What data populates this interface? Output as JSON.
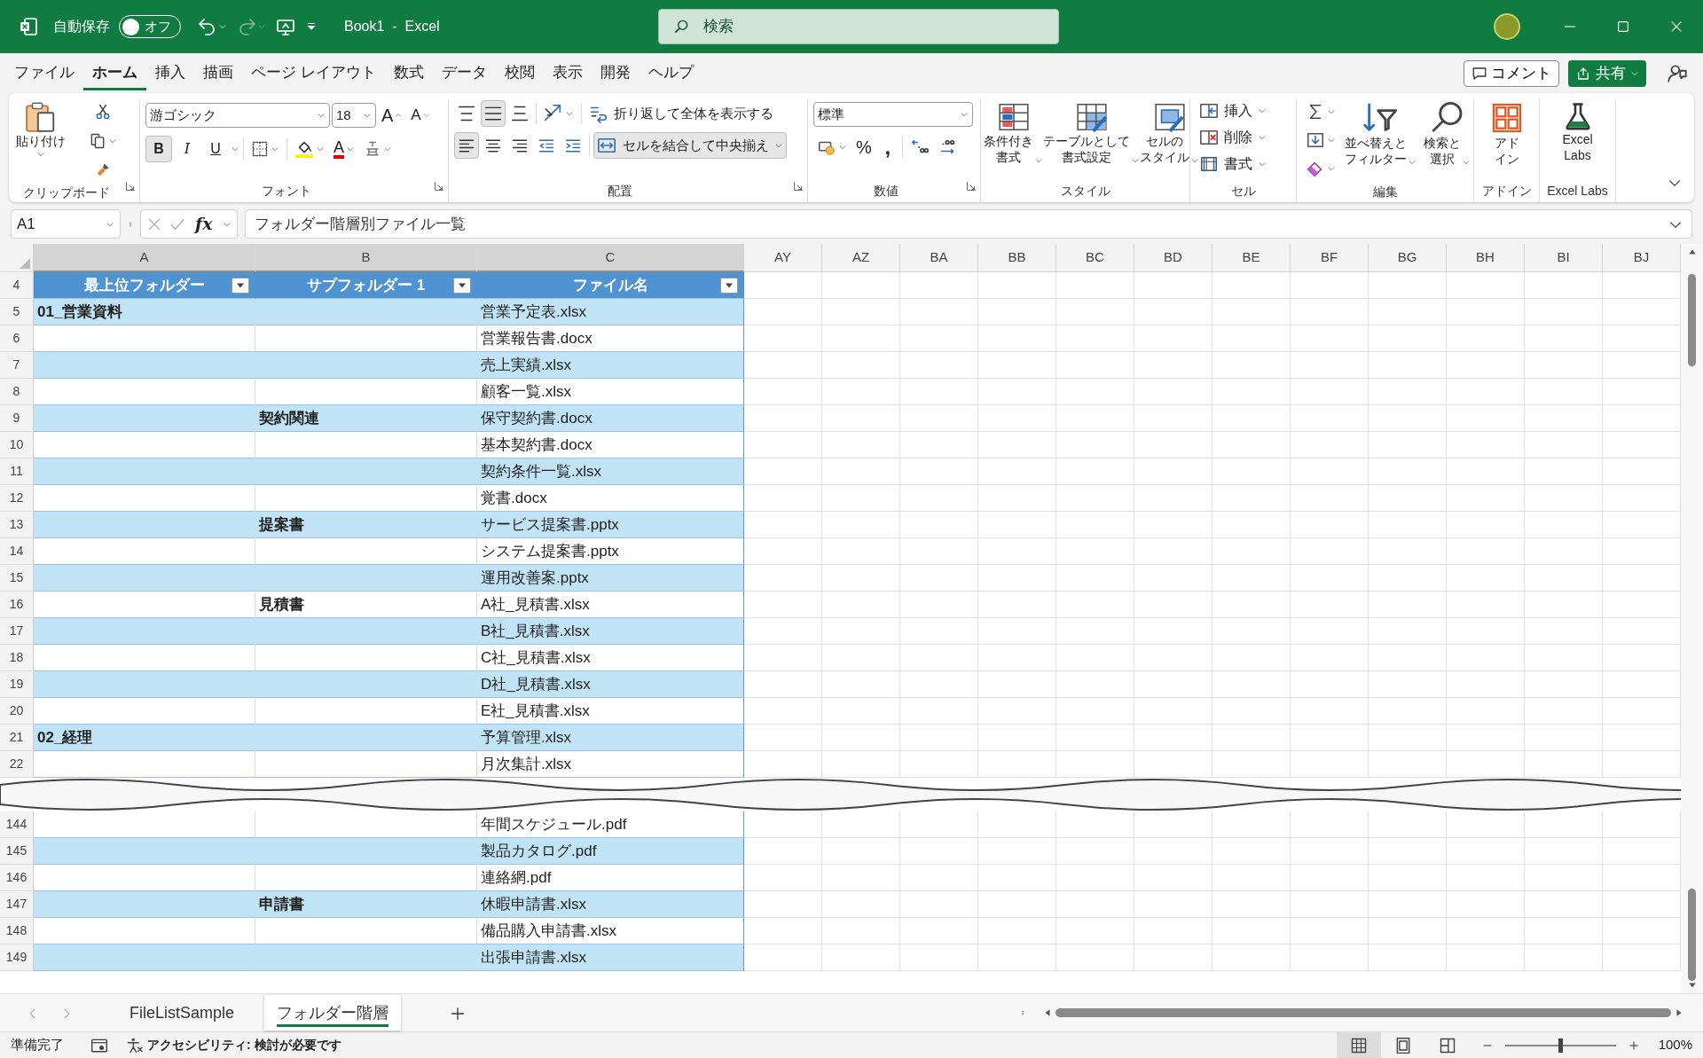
{
  "title_bar": {
    "autosave_label": "自動保存",
    "autosave": {
      "label": "オフ",
      "on": false
    },
    "title": "Book1  -  Excel",
    "search": {
      "placeholder": "検索"
    }
  },
  "menu_tabs": [
    {
      "label": "ファイル",
      "selected": false
    },
    {
      "label": "ホーム",
      "selected": true
    },
    {
      "label": "挿入",
      "selected": false
    },
    {
      "label": "描画",
      "selected": false
    },
    {
      "label": "ページ レイアウト",
      "selected": false
    },
    {
      "label": "数式",
      "selected": false
    },
    {
      "label": "データ",
      "selected": false
    },
    {
      "label": "校閲",
      "selected": false
    },
    {
      "label": "表示",
      "selected": false
    },
    {
      "label": "開発",
      "selected": false
    },
    {
      "label": "ヘルプ",
      "selected": false
    }
  ],
  "comment_button": "コメント",
  "share_button": "共有",
  "ribbon": {
    "clipboard": {
      "paste": "貼り付け",
      "label": "クリップボード"
    },
    "font": {
      "name": "游ゴシック",
      "size": "18",
      "grow": "A",
      "shrink": "A",
      "bold": {
        "label": "B",
        "on": true
      },
      "italic": {
        "label": "I",
        "on": false
      },
      "underline": {
        "label": "U",
        "on": false
      },
      "font_color": "A",
      "label": "フォント"
    },
    "alignment": {
      "vertical": [
        {
          "selected": false
        },
        {
          "selected": true
        },
        {
          "selected": false
        }
      ],
      "horizontal": [
        {
          "selected": true
        },
        {
          "selected": false
        },
        {
          "selected": false
        }
      ],
      "wrap": {
        "label": "折り返して全体を表示する",
        "on": false
      },
      "merge": {
        "label": "セルを結合して中央揃え",
        "on": true
      },
      "label": "配置"
    },
    "number": {
      "format": "標準",
      "percent": "%",
      "comma": ",",
      "label": "数値"
    },
    "styles": {
      "items": [
        [
          "条件付き",
          "書式"
        ],
        [
          "テーブルとして",
          "書式設定"
        ],
        [
          "セルの",
          "スタイル"
        ]
      ],
      "label": "スタイル"
    },
    "cells": {
      "items": [
        "挿入",
        "削除",
        "書式"
      ],
      "label": "セル"
    },
    "editing": {
      "items": [
        [
          "並べ替えと",
          "フィルター"
        ],
        [
          "検索と",
          "選択"
        ]
      ],
      "label": "編集"
    },
    "addins": {
      "button": [
        "アド",
        "イン"
      ],
      "label": "アドイン"
    },
    "excel_labs": {
      "button": [
        "Excel",
        "Labs"
      ],
      "label": "Excel Labs"
    }
  },
  "formula_bar": {
    "name_box": "A1",
    "fx": "fx",
    "formula": "フォルダー階層別ファイル一覧"
  },
  "columns": [
    {
      "label": "A",
      "highlighted": true
    },
    {
      "label": "B",
      "highlighted": true
    },
    {
      "label": "C",
      "highlighted": true
    },
    {
      "label": "AY",
      "highlighted": false
    },
    {
      "label": "AZ",
      "highlighted": false
    },
    {
      "label": "BA",
      "highlighted": false
    },
    {
      "label": "BB",
      "highlighted": false
    },
    {
      "label": "BC",
      "highlighted": false
    },
    {
      "label": "BD",
      "highlighted": false
    },
    {
      "label": "BE",
      "highlighted": false
    },
    {
      "label": "BF",
      "highlighted": false
    },
    {
      "label": "BG",
      "highlighted": false
    },
    {
      "label": "BH",
      "highlighted": false
    },
    {
      "label": "BI",
      "highlighted": false
    },
    {
      "label": "BJ",
      "highlighted": false
    }
  ],
  "table": {
    "header_row": "4",
    "headers": [
      "最上位フォルダー",
      "サブフォルダー 1",
      "ファイル名"
    ],
    "rows": [
      {
        "row": "5",
        "a": "01_営業資料",
        "c": "営業予定表.xlsx",
        "shaded": true
      },
      {
        "row": "6",
        "c": "営業報告書.docx",
        "shaded": false
      },
      {
        "row": "7",
        "c": "売上実績.xlsx",
        "shaded": true
      },
      {
        "row": "8",
        "c": "顧客一覧.xlsx",
        "shaded": false
      },
      {
        "row": "9",
        "b": "契約関連",
        "c": "保守契約書.docx",
        "shaded": true
      },
      {
        "row": "10",
        "c": "基本契約書.docx",
        "shaded": false
      },
      {
        "row": "11",
        "c": "契約条件一覧.xlsx",
        "shaded": true
      },
      {
        "row": "12",
        "c": "覚書.docx",
        "shaded": false
      },
      {
        "row": "13",
        "b": "提案書",
        "c": "サービス提案書.pptx",
        "shaded": true
      },
      {
        "row": "14",
        "c": "システム提案書.pptx",
        "shaded": false
      },
      {
        "row": "15",
        "c": "運用改善案.pptx",
        "shaded": true
      },
      {
        "row": "16",
        "b": "見積書",
        "c": "A社_見積書.xlsx",
        "shaded": false
      },
      {
        "row": "17",
        "c": "B社_見積書.xlsx",
        "shaded": true
      },
      {
        "row": "18",
        "c": "C社_見積書.xlsx",
        "shaded": false
      },
      {
        "row": "19",
        "c": "D社_見積書.xlsx",
        "shaded": true
      },
      {
        "row": "20",
        "c": "E社_見積書.xlsx",
        "shaded": false
      },
      {
        "row": "21",
        "a": "02_経理",
        "c": "予算管理.xlsx",
        "shaded": true
      },
      {
        "row": "22",
        "c": "月次集計.xlsx",
        "shaded": false
      }
    ],
    "rows_after_break": [
      {
        "row": "144",
        "c": "年間スケジュール.pdf",
        "shaded": false
      },
      {
        "row": "145",
        "c": "製品カタログ.pdf",
        "shaded": true
      },
      {
        "row": "146",
        "c": "連絡網.pdf",
        "shaded": false
      },
      {
        "row": "147",
        "b": "申請書",
        "c": "休暇申請書.xlsx",
        "shaded": true
      },
      {
        "row": "148",
        "c": "備品購入申請書.xlsx",
        "shaded": false
      },
      {
        "row": "149",
        "c": "出張申請書.xlsx",
        "shaded": true
      }
    ]
  },
  "sheet_tabs": [
    {
      "label": "FileListSample",
      "selected": false
    },
    {
      "label": "フォルダー階層",
      "selected": true
    }
  ],
  "status_bar": {
    "ready": "準備完了",
    "accessibility": "アクセシビリティ: 検討が必要です",
    "views": [
      {
        "selected": true
      },
      {
        "selected": false
      },
      {
        "selected": false
      }
    ],
    "zoom": {
      "level": 0.5,
      "label": "100%"
    }
  }
}
